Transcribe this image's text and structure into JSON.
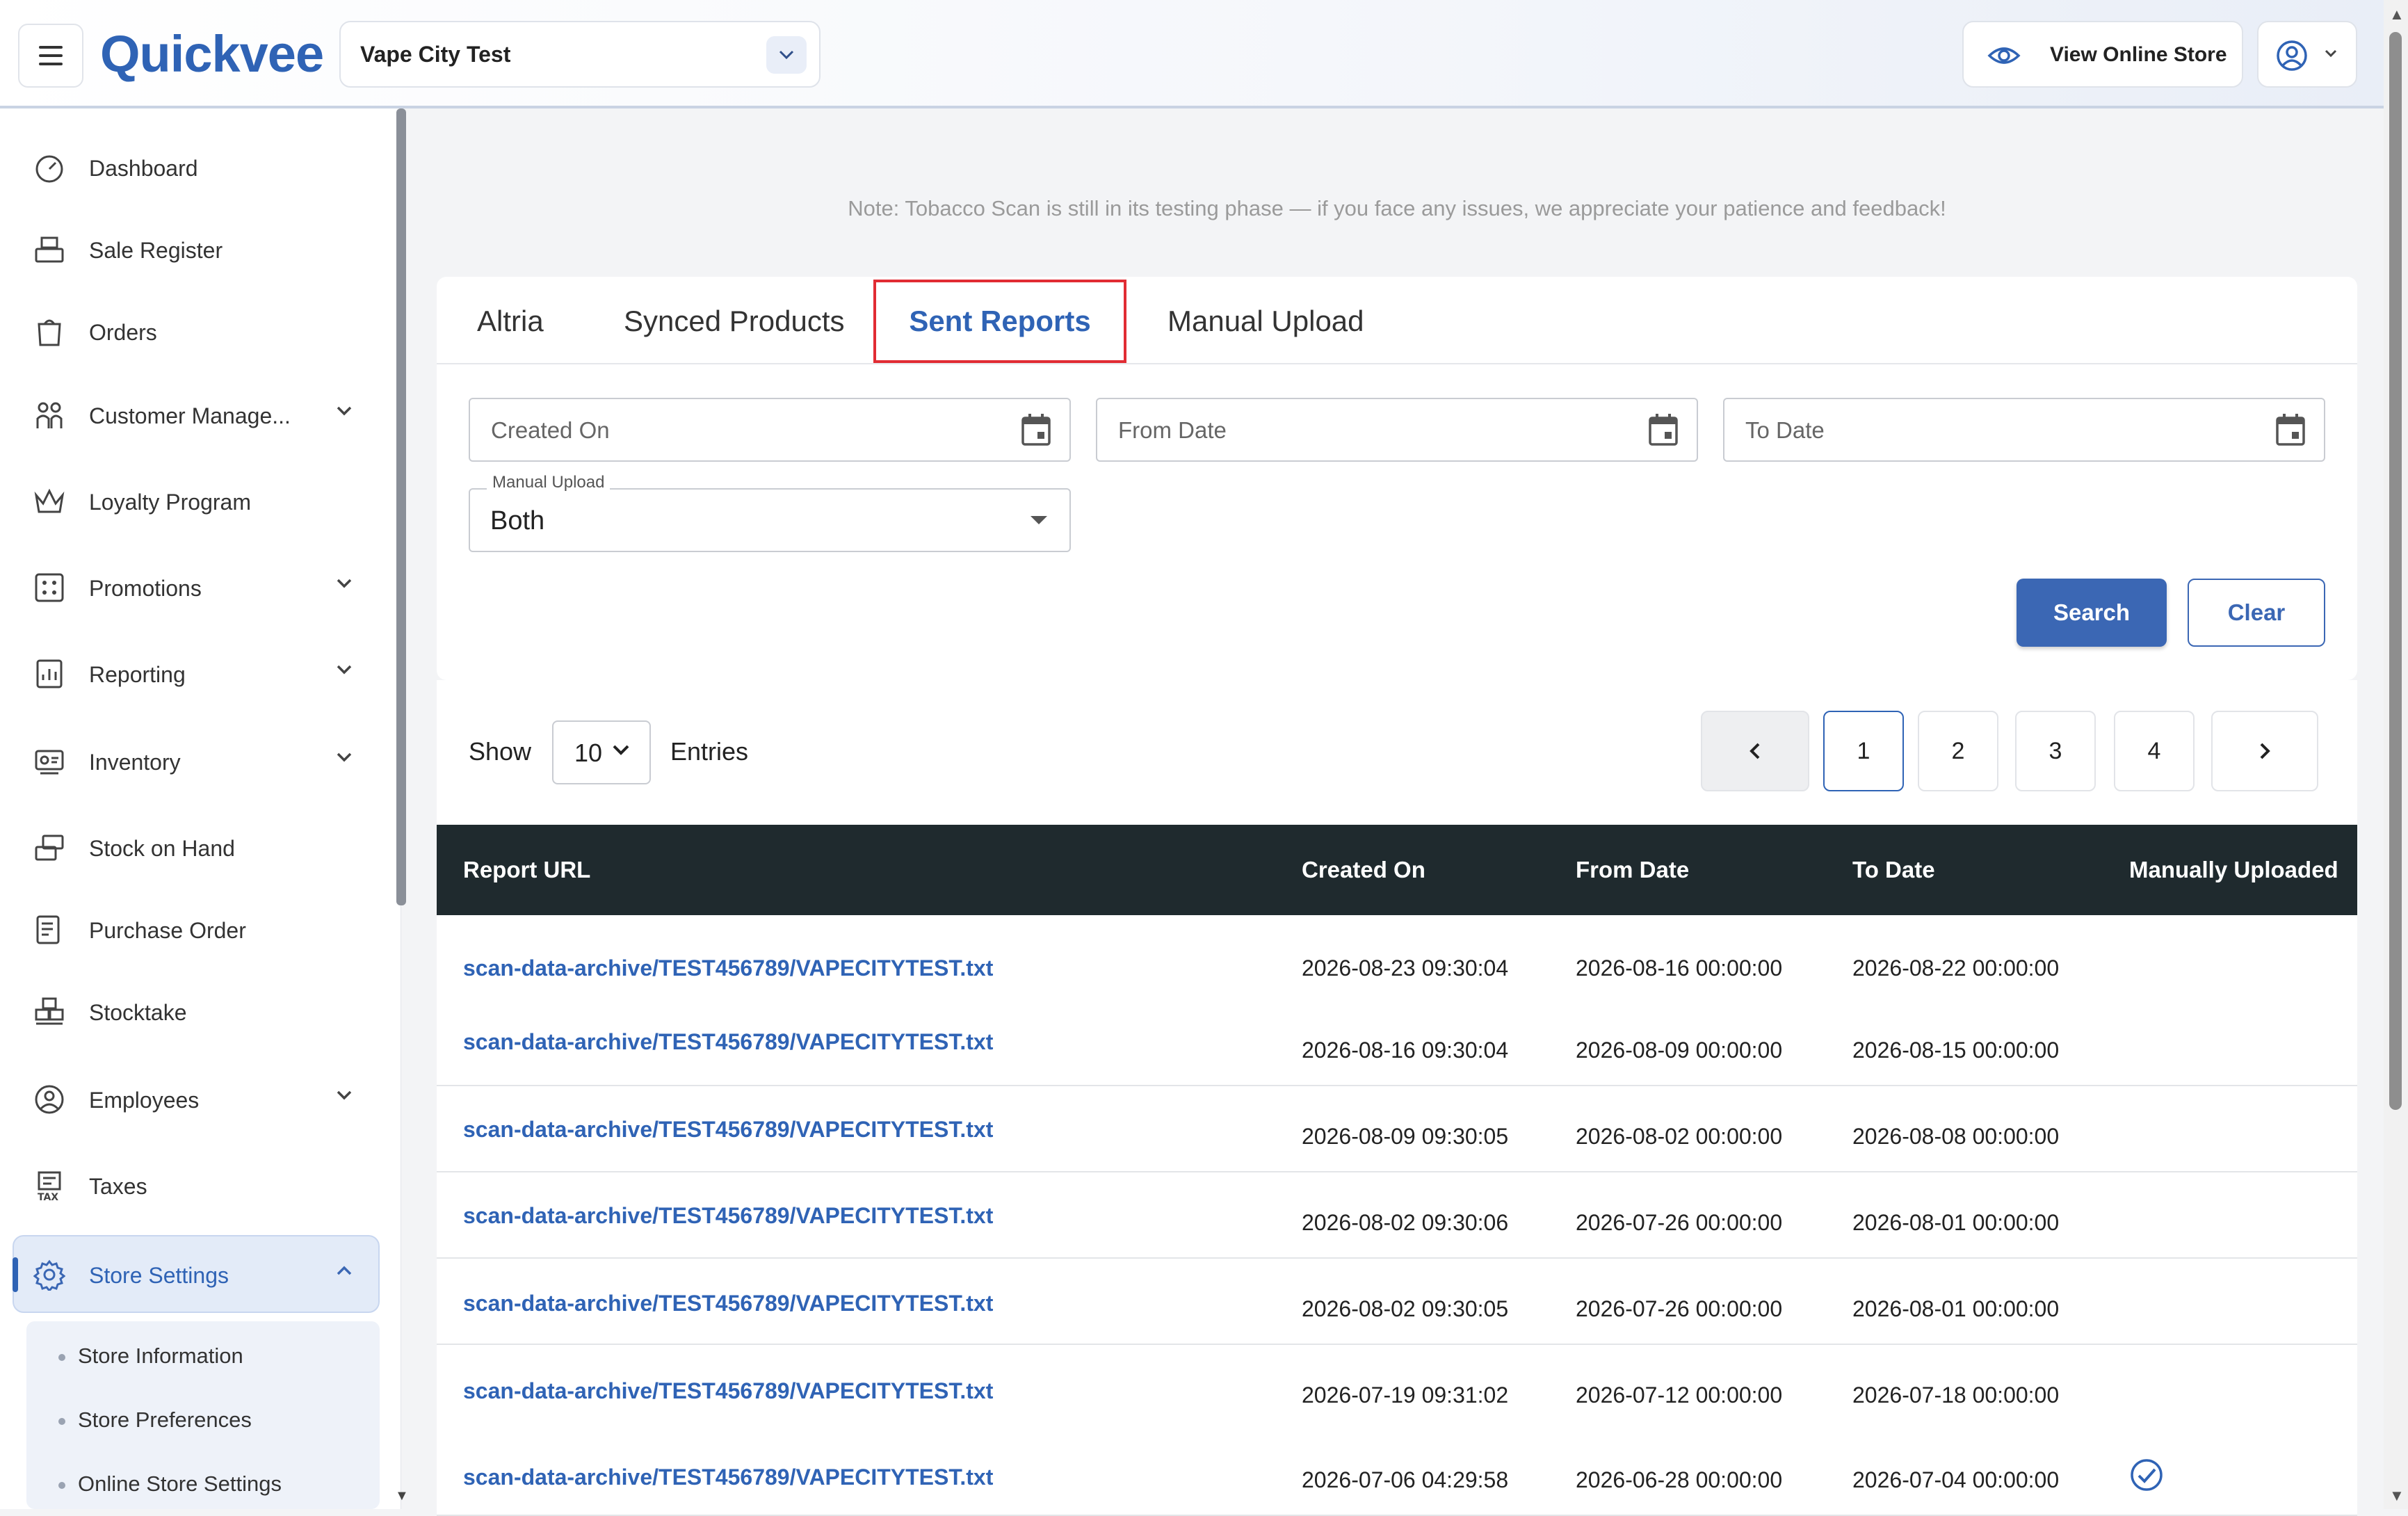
{
  "header": {
    "logo": "Quickvee",
    "store_name": "Vape City Test",
    "view_store_label": "View Online Store"
  },
  "sidebar": {
    "items": [
      {
        "label": "Dashboard",
        "icon": "dashboard-icon",
        "has_chevron": false
      },
      {
        "label": "Sale Register",
        "icon": "register-icon",
        "has_chevron": false
      },
      {
        "label": "Orders",
        "icon": "orders-icon",
        "has_chevron": false
      },
      {
        "label": "Customer Manage...",
        "icon": "customers-icon",
        "has_chevron": true
      },
      {
        "label": "Loyalty Program",
        "icon": "crown-icon",
        "has_chevron": false
      },
      {
        "label": "Promotions",
        "icon": "promotions-icon",
        "has_chevron": true
      },
      {
        "label": "Reporting",
        "icon": "reporting-icon",
        "has_chevron": true
      },
      {
        "label": "Inventory",
        "icon": "inventory-icon",
        "has_chevron": true
      },
      {
        "label": "Stock on Hand",
        "icon": "stock-icon",
        "has_chevron": false
      },
      {
        "label": "Purchase Order",
        "icon": "purchase-order-icon",
        "has_chevron": false
      },
      {
        "label": "Stocktake",
        "icon": "stocktake-icon",
        "has_chevron": false
      },
      {
        "label": "Employees",
        "icon": "employees-icon",
        "has_chevron": true
      },
      {
        "label": "Taxes",
        "icon": "tax-icon",
        "has_chevron": false
      },
      {
        "label": "Store Settings",
        "icon": "gear-icon",
        "has_chevron": true,
        "active": true
      }
    ],
    "sub_items": [
      "Store Information",
      "Store Preferences",
      "Online Store Settings"
    ]
  },
  "note": "Note: Tobacco Scan is still in its testing phase — if you face any issues, we appreciate your patience and feedback!",
  "tabs": [
    "Altria",
    "Synced Products",
    "Sent Reports",
    "Manual Upload"
  ],
  "active_tab": "Sent Reports",
  "filters": {
    "created_on_placeholder": "Created On",
    "from_date_placeholder": "From Date",
    "to_date_placeholder": "To Date",
    "manual_upload_label": "Manual Upload",
    "manual_upload_value": "Both",
    "search_label": "Search",
    "clear_label": "Clear"
  },
  "pagination": {
    "show_label": "Show",
    "entries_value": "10",
    "entries_label": "Entries",
    "pages": [
      "1",
      "2",
      "3",
      "4"
    ],
    "current_page": "1"
  },
  "table": {
    "columns": [
      "Report URL",
      "Created On",
      "From Date",
      "To Date",
      "Manually Uploaded"
    ],
    "rows": [
      {
        "url": "scan-data-archive/TEST456789/VAPECITYTEST.txt",
        "created": "2026-08-23 09:30:04",
        "from": "2026-08-16 00:00:00",
        "to": "2026-08-22 00:00:00",
        "manual": false
      },
      {
        "url": "scan-data-archive/TEST456789/VAPECITYTEST.txt",
        "created": "2026-08-16 09:30:04",
        "from": "2026-08-09 00:00:00",
        "to": "2026-08-15 00:00:00",
        "manual": false
      },
      {
        "url": "scan-data-archive/TEST456789/VAPECITYTEST.txt",
        "created": "2026-08-09 09:30:05",
        "from": "2026-08-02 00:00:00",
        "to": "2026-08-08 00:00:00",
        "manual": false
      },
      {
        "url": "scan-data-archive/TEST456789/VAPECITYTEST.txt",
        "created": "2026-08-02 09:30:06",
        "from": "2026-07-26 00:00:00",
        "to": "2026-08-01 00:00:00",
        "manual": false
      },
      {
        "url": "scan-data-archive/TEST456789/VAPECITYTEST.txt",
        "created": "2026-08-02 09:30:05",
        "from": "2026-07-26 00:00:00",
        "to": "2026-08-01 00:00:00",
        "manual": false
      },
      {
        "url": "scan-data-archive/TEST456789/VAPECITYTEST.txt",
        "created": "2026-07-19 09:31:02",
        "from": "2026-07-12 00:00:00",
        "to": "2026-07-18 00:00:00",
        "manual": false
      },
      {
        "url": "scan-data-archive/TEST456789/VAPECITYTEST.txt",
        "created": "2026-07-06 04:29:58",
        "from": "2026-06-28 00:00:00",
        "to": "2026-07-04 00:00:00",
        "manual": true
      }
    ]
  },
  "colors": {
    "brand": "#2f63b5",
    "table_header": "#1f2a2e",
    "active_tab_outline": "#e12c33"
  }
}
